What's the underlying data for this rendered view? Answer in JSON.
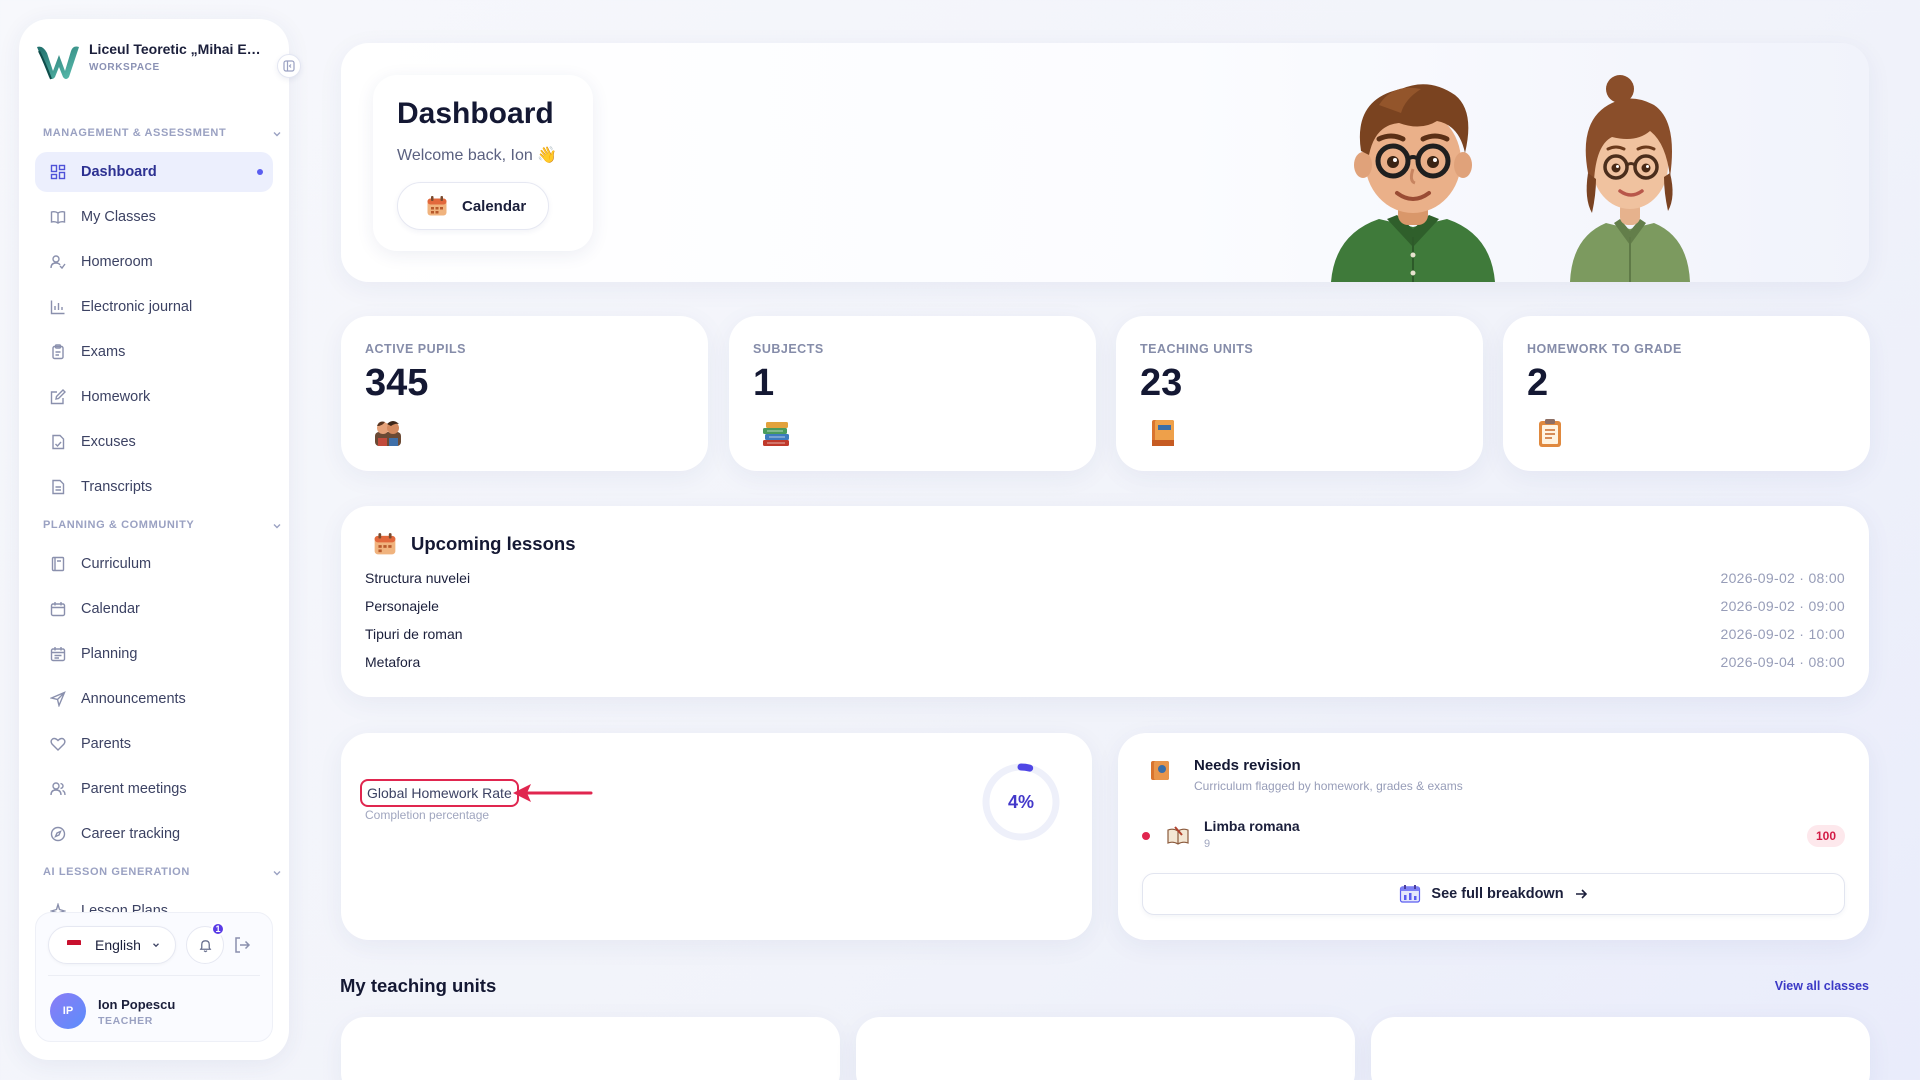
{
  "workspace": {
    "name": "Liceul Teoretic „Mihai Eminescu”",
    "label": "WORKSPACE"
  },
  "sidebar": {
    "sections": [
      {
        "label": "MANAGEMENT & ASSESSMENT"
      },
      {
        "label": "PLANNING & COMMUNITY"
      },
      {
        "label": "AI LESSON GENERATION"
      }
    ],
    "items": [
      {
        "label": "Dashboard",
        "icon": "grid-icon",
        "active": true
      },
      {
        "label": "My Classes",
        "icon": "book-open-icon"
      },
      {
        "label": "Homeroom",
        "icon": "user-check-icon"
      },
      {
        "label": "Electronic journal",
        "icon": "bar-chart-icon"
      },
      {
        "label": "Exams",
        "icon": "clipboard-icon"
      },
      {
        "label": "Homework",
        "icon": "pencil-square-icon"
      },
      {
        "label": "Excuses",
        "icon": "file-check-icon"
      },
      {
        "label": "Transcripts",
        "icon": "file-text-icon"
      },
      {
        "label": "Curriculum",
        "icon": "book-icon"
      },
      {
        "label": "Calendar",
        "icon": "calendar-icon"
      },
      {
        "label": "Planning",
        "icon": "calendar-list-icon"
      },
      {
        "label": "Announcements",
        "icon": "send-icon"
      },
      {
        "label": "Parents",
        "icon": "heart-icon"
      },
      {
        "label": "Parent meetings",
        "icon": "users-icon"
      },
      {
        "label": "Career tracking",
        "icon": "compass-icon"
      },
      {
        "label": "Lesson Plans",
        "icon": "sparkle-icon"
      }
    ],
    "footer": {
      "language": "English",
      "notifications": "1",
      "user_name": "Ion Popescu",
      "user_role": "TEACHER",
      "user_initials": "IP"
    }
  },
  "hero": {
    "title": "Dashboard",
    "subtitle": "Welcome back, Ion 👋",
    "calendar_button": "Calendar"
  },
  "stats": [
    {
      "label": "ACTIVE PUPILS",
      "value": "345",
      "icon": "pupils-icon"
    },
    {
      "label": "SUBJECTS",
      "value": "1",
      "icon": "books-icon"
    },
    {
      "label": "TEACHING UNITS",
      "value": "23",
      "icon": "notebook-icon"
    },
    {
      "label": "HOMEWORK TO GRADE",
      "value": "2",
      "icon": "clipboard-icon"
    }
  ],
  "upcoming": {
    "title": "Upcoming lessons",
    "lessons": [
      {
        "name": "Structura nuvelei",
        "time": "2026-09-02 · 08:00"
      },
      {
        "name": "Personajele",
        "time": "2026-09-02 · 09:00"
      },
      {
        "name": "Tipuri de roman",
        "time": "2026-09-02 · 10:00"
      },
      {
        "name": "Metafora",
        "time": "2026-09-04 · 08:00"
      }
    ]
  },
  "homework_rate": {
    "title": "Global Homework Rate",
    "subtitle": "Completion percentage",
    "percent": 4,
    "percent_label": "4%",
    "ring_color": "#4f46e5",
    "highlight_color": "#e0264f"
  },
  "revision": {
    "title": "Needs revision",
    "subtitle": "Curriculum flagged by homework, grades & exams",
    "items": [
      {
        "name": "Limba romana",
        "grade": "9",
        "score": "100"
      }
    ],
    "button": "See full breakdown"
  },
  "teaching_units": {
    "title": "My teaching units",
    "link": "View all classes"
  }
}
